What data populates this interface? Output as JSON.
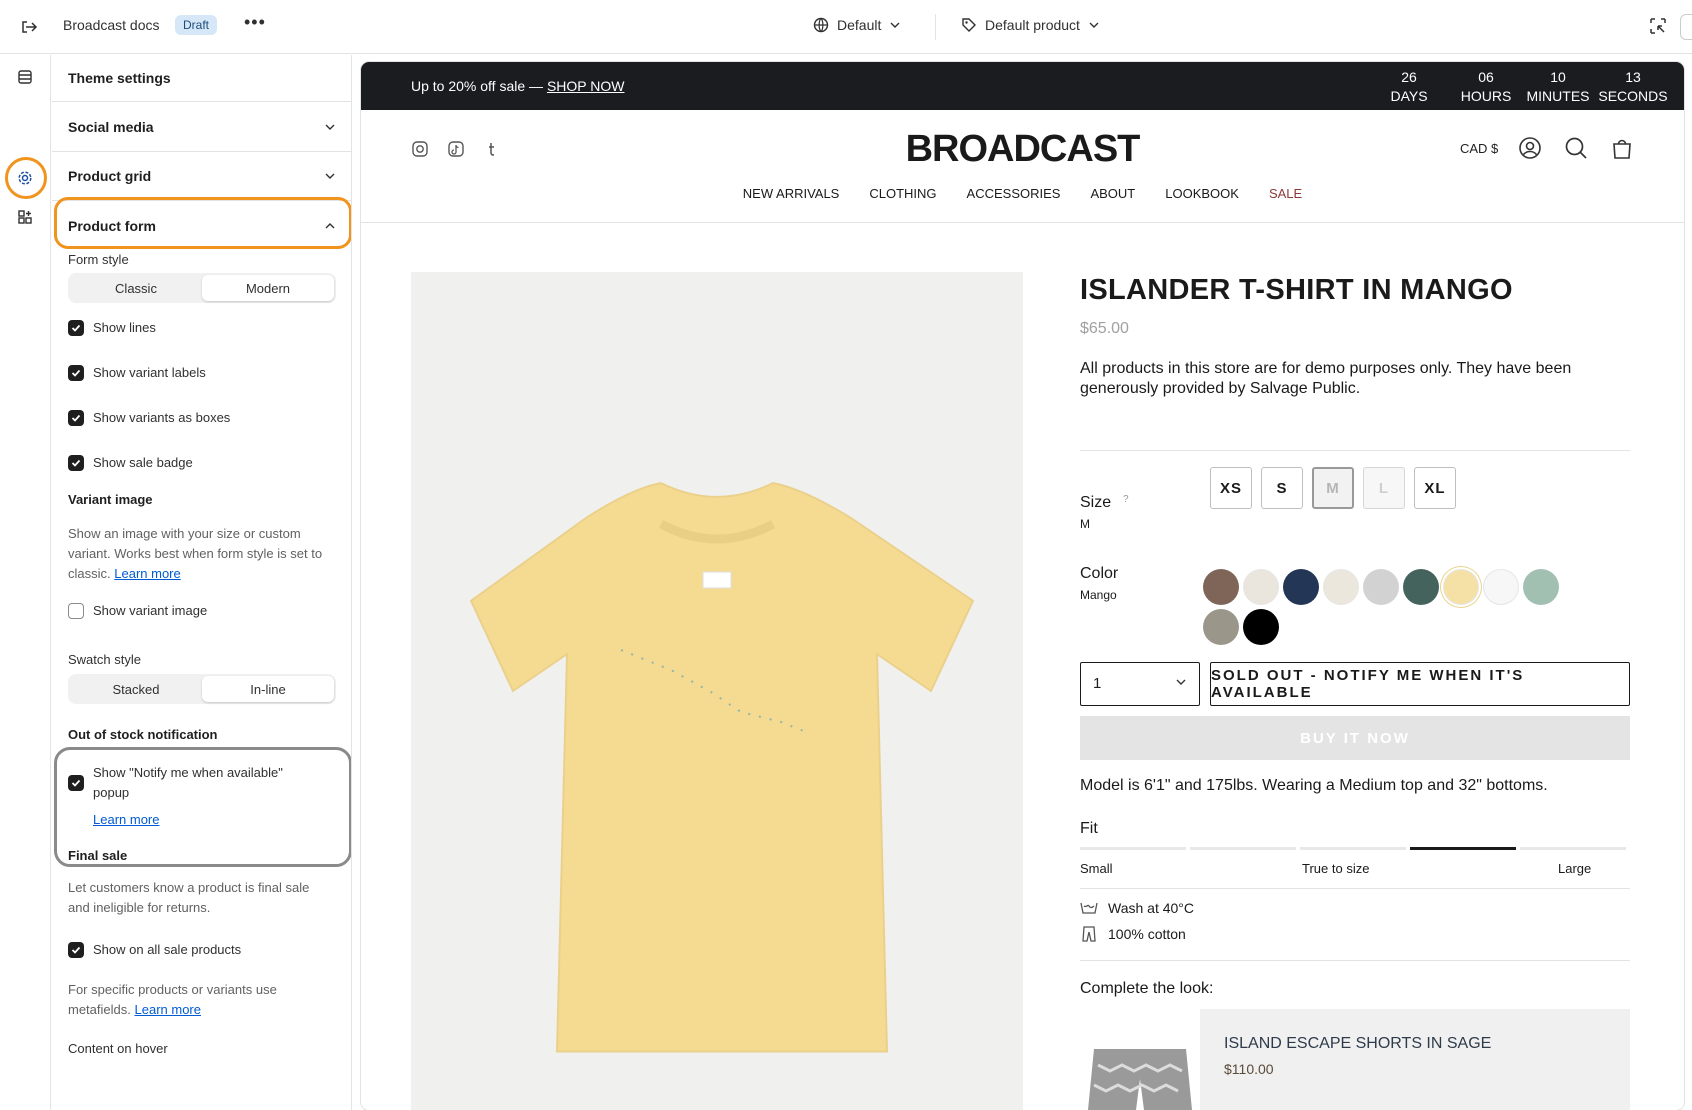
{
  "topbar": {
    "title": "Broadcast docs",
    "badge": "Draft",
    "more": "•••",
    "theme_selector": "Default",
    "product_selector": "Default product"
  },
  "panel": {
    "header": "Theme settings",
    "sections": [
      "Social media",
      "Product grid",
      "Product form"
    ],
    "form_style": {
      "label": "Form style",
      "options": [
        "Classic",
        "Modern"
      ],
      "selected": "Modern"
    },
    "checkboxes": [
      {
        "label": "Show lines",
        "checked": true
      },
      {
        "label": "Show variant labels",
        "checked": true
      },
      {
        "label": "Show variants as boxes",
        "checked": true
      },
      {
        "label": "Show sale badge",
        "checked": true
      }
    ],
    "variant_image": {
      "title": "Variant image",
      "help": "Show an image with your size or custom variant. Works best when form style is set to classic.",
      "learn_more": "Learn more",
      "checkbox": "Show variant image"
    },
    "swatch_style": {
      "label": "Swatch style",
      "options": [
        "Stacked",
        "In-line"
      ],
      "selected": "In-line"
    },
    "oos": {
      "title": "Out of stock notification",
      "checkbox": "Show \"Notify me when available\" popup",
      "learn_more": "Learn more"
    },
    "final_sale": {
      "title": "Final sale",
      "help": "Let customers know a product is final sale and ineligible for returns.",
      "checkbox": "Show on all sale products",
      "help2": "For specific products or variants use metafields.",
      "learn_more": "Learn more"
    },
    "content_on_hover": "Content on hover"
  },
  "store": {
    "announcement": "Up to 20% off sale —",
    "announcement_link": "SHOP NOW",
    "countdown": [
      {
        "value": "26",
        "unit": "DAYS"
      },
      {
        "value": "06",
        "unit": "HOURS"
      },
      {
        "value": "10",
        "unit": "MINUTES"
      },
      {
        "value": "13",
        "unit": "SECONDS"
      }
    ],
    "logo": "BROADCAST",
    "currency": "CAD $",
    "nav": [
      "NEW ARRIVALS",
      "CLOTHING",
      "ACCESSORIES",
      "ABOUT",
      "LOOKBOOK",
      "SALE"
    ]
  },
  "product": {
    "title": "ISLANDER T-SHIRT IN MANGO",
    "price": "$65.00",
    "description": "All products in this store are for demo purposes only. They have been generously provided by Salvage Public.",
    "size_label": "Size",
    "size_help": "?",
    "size_selected": "M",
    "sizes": [
      "XS",
      "S",
      "M",
      "L",
      "XL"
    ],
    "color_label": "Color",
    "color_selected": "Mango",
    "swatches": [
      "#7e6558",
      "#ebe6dd",
      "#243656",
      "#ebe7dc",
      "#d2d2d2",
      "#45635d",
      "#f5e1a5",
      "#f7f7f7",
      "#a1c0b2",
      "#9b968a",
      "#000000"
    ],
    "quantity": "1",
    "soldout_button": "SOLD OUT - NOTIFY ME WHEN IT'S AVAILABLE",
    "buy_button": "BUY IT NOW",
    "model_info": "Model is 6'1\" and 175lbs. Wearing a Medium top and 32\" bottoms.",
    "fit_label": "Fit",
    "fit_scale": [
      "Small",
      "True to size",
      "Large"
    ],
    "fit_value_segment": 3,
    "care": [
      "Wash at 40°C",
      "100% cotton"
    ],
    "complete_look": "Complete the look:",
    "related": {
      "name": "ISLAND ESCAPE SHORTS IN SAGE",
      "price": "$110.00"
    }
  },
  "colors": {
    "highlight": "#f0941e",
    "annotation_ring": "#8a8a8a",
    "announcement_bg": "#1a1c1f",
    "sale_nav": "#8a3a3a"
  }
}
